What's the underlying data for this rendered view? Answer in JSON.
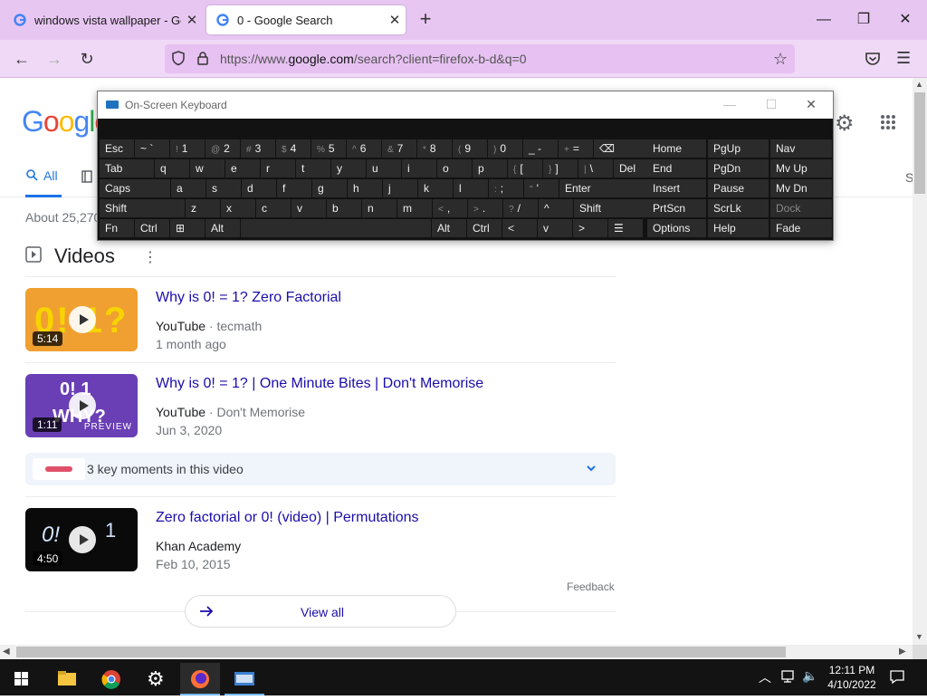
{
  "browser": {
    "tabs": [
      {
        "title": "windows vista wallpaper - Goog",
        "active": false
      },
      {
        "title": "0 - Google Search",
        "active": true
      }
    ],
    "url_prefix": "https://www.",
    "url_domain": "google.com",
    "url_rest": "/search?client=firefox-b-d&q=0"
  },
  "page": {
    "logo_text": "Google",
    "tab_all": "All",
    "results_count": "About 25,270",
    "videos_title": "Videos",
    "videos": [
      {
        "title": "Why is 0! = 1? Zero Factorial",
        "source": "YouTube",
        "channel": "tecmath",
        "date": "1 month ago",
        "duration": "5:14",
        "thumb_color": "#f0a030"
      },
      {
        "title": "Why is 0! = 1? | One Minute Bites | Don't Memorise",
        "source": "YouTube",
        "channel": "Don't Memorise",
        "date": "Jun 3, 2020",
        "duration": "1:11",
        "thumb_color": "#6a3fb5",
        "badge": "PREVIEW"
      },
      {
        "title": "Zero factorial or 0! (video) | Permutations",
        "source": "Khan Academy",
        "channel": "",
        "date": "Feb 10, 2015",
        "duration": "4:50",
        "thumb_color": "#0a0a0a"
      }
    ],
    "key_moments": "3 key moments in this video",
    "feedback": "Feedback",
    "view_all": "View all",
    "right_edge_letter": "S"
  },
  "keyboard": {
    "title": "On-Screen Keyboard",
    "rows": [
      [
        {
          "label": "Esc"
        },
        {
          "label": "~ `"
        },
        {
          "sub": "!",
          "label": "1"
        },
        {
          "sub": "@",
          "label": "2"
        },
        {
          "sub": "#",
          "label": "3"
        },
        {
          "sub": "$",
          "label": "4"
        },
        {
          "sub": "%",
          "label": "5"
        },
        {
          "sub": "^",
          "label": "6"
        },
        {
          "sub": "&",
          "label": "7"
        },
        {
          "sub": "*",
          "label": "8"
        },
        {
          "sub": "(",
          "label": "9"
        },
        {
          "sub": ")",
          "label": "0"
        },
        {
          "label": "_ -"
        },
        {
          "sub": "+",
          "label": "="
        },
        {
          "label": "⌫"
        }
      ],
      [
        {
          "label": "Tab"
        },
        {
          "label": "q"
        },
        {
          "label": "w"
        },
        {
          "label": "e"
        },
        {
          "label": "r"
        },
        {
          "label": "t"
        },
        {
          "label": "y"
        },
        {
          "label": "u"
        },
        {
          "label": "i"
        },
        {
          "label": "o"
        },
        {
          "label": "p"
        },
        {
          "sub": "{",
          "label": "["
        },
        {
          "sub": "}",
          "label": "]"
        },
        {
          "sub": "|",
          "label": "\\"
        },
        {
          "label": "Del"
        }
      ],
      [
        {
          "label": "Caps"
        },
        {
          "label": "a"
        },
        {
          "label": "s"
        },
        {
          "label": "d"
        },
        {
          "label": "f"
        },
        {
          "label": "g"
        },
        {
          "label": "h"
        },
        {
          "label": "j"
        },
        {
          "label": "k"
        },
        {
          "label": "l"
        },
        {
          "sub": ":",
          "label": ";"
        },
        {
          "sub": "\"",
          "label": "'"
        },
        {
          "label": "Enter"
        }
      ],
      [
        {
          "label": "Shift"
        },
        {
          "label": "z"
        },
        {
          "label": "x"
        },
        {
          "label": "c"
        },
        {
          "label": "v"
        },
        {
          "label": "b"
        },
        {
          "label": "n"
        },
        {
          "label": "m"
        },
        {
          "sub": "<",
          "label": ","
        },
        {
          "sub": ">",
          "label": "."
        },
        {
          "sub": "?",
          "label": "/"
        },
        {
          "label": "^"
        },
        {
          "label": "Shift"
        }
      ],
      [
        {
          "label": "Fn"
        },
        {
          "label": "Ctrl"
        },
        {
          "label": "⊞"
        },
        {
          "label": "Alt"
        },
        {
          "label": ""
        },
        {
          "label": "Alt"
        },
        {
          "label": "Ctrl"
        },
        {
          "label": "<"
        },
        {
          "label": "v"
        },
        {
          "label": ">"
        },
        {
          "label": "☰"
        }
      ]
    ],
    "side_rows": [
      [
        "Home",
        "PgUp",
        "Nav"
      ],
      [
        "End",
        "PgDn",
        "Mv Up"
      ],
      [
        "Insert",
        "Pause",
        "Mv Dn"
      ],
      [
        "PrtScn",
        "ScrLk",
        "Dock"
      ],
      [
        "Options",
        "Help",
        "Fade"
      ]
    ]
  },
  "taskbar": {
    "time": "12:11 PM",
    "date": "4/10/2022"
  }
}
